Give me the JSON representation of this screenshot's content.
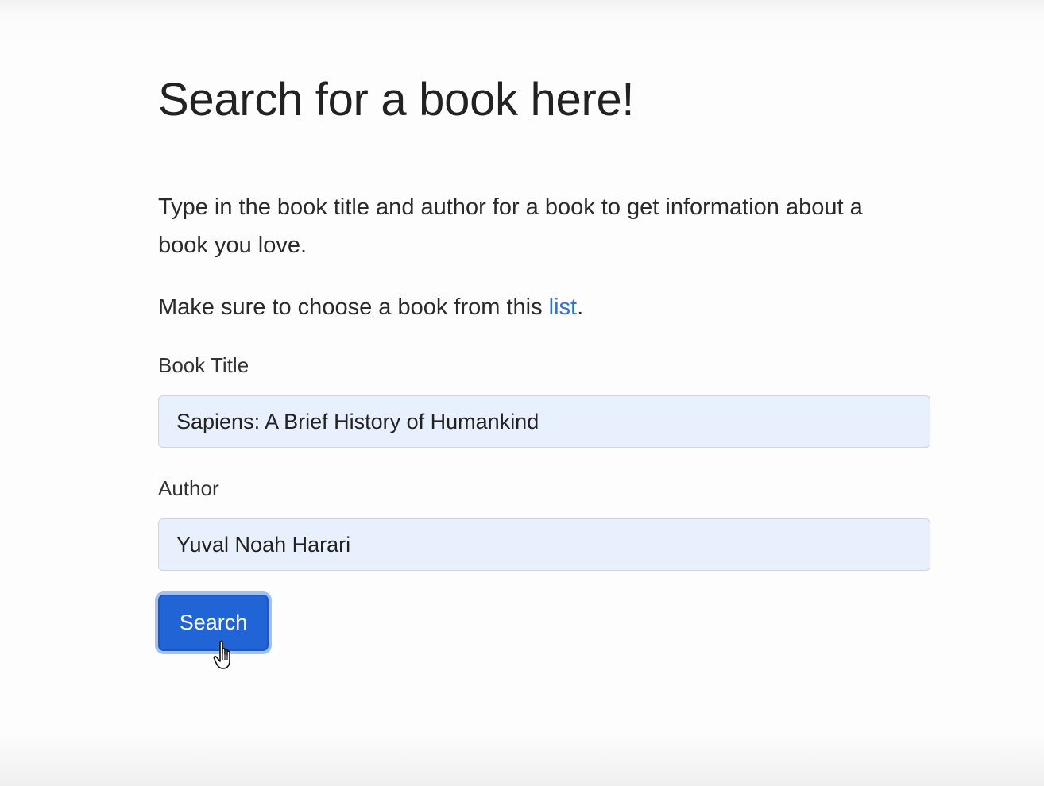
{
  "page": {
    "heading": "Search for a book here!",
    "intro": "Type in the book title and author for a book to get information about a book you love.",
    "choose_prefix": "Make sure to choose a book from this ",
    "choose_link": "list",
    "choose_suffix": "."
  },
  "form": {
    "title_label": "Book Title",
    "title_value": "Sapiens: A Brief History of Humankind",
    "author_label": "Author",
    "author_value": "Yuval Noah Harari",
    "search_label": "Search"
  },
  "colors": {
    "link": "#2f6fd3",
    "button": "#2164d6",
    "input_bg": "#e8effd"
  },
  "icons": {
    "cursor": "hand-pointer-icon"
  }
}
